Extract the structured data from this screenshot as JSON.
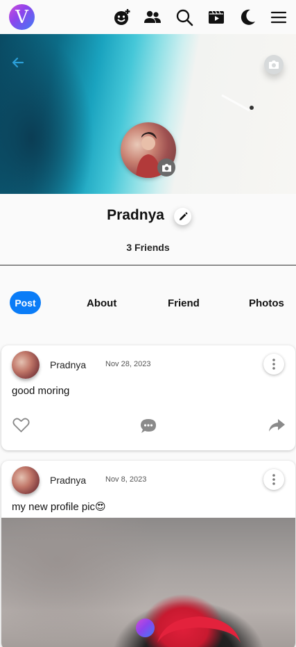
{
  "app": {
    "logo_letter": "V"
  },
  "topbar": {
    "icons": [
      "add-emoji-icon",
      "friends-icon",
      "search-icon",
      "reels-icon",
      "dark-mode-moon-icon",
      "menu-icon"
    ]
  },
  "profile": {
    "name": "Pradnya",
    "friends_count": "3 Friends"
  },
  "tabs": [
    {
      "label": "Post",
      "active": true
    },
    {
      "label": "About",
      "active": false
    },
    {
      "label": "Friend",
      "active": false
    },
    {
      "label": "Photos",
      "active": false
    }
  ],
  "posts": [
    {
      "author": "Pradnya",
      "date": "Nov 28, 2023",
      "text": "good moring"
    },
    {
      "author": "Pradnya",
      "date": "Nov 8, 2023",
      "text": "my new profile pic😍"
    }
  ],
  "colors": {
    "accent": "#0a7cf7",
    "cover_arrow": "#2b9fd8"
  }
}
